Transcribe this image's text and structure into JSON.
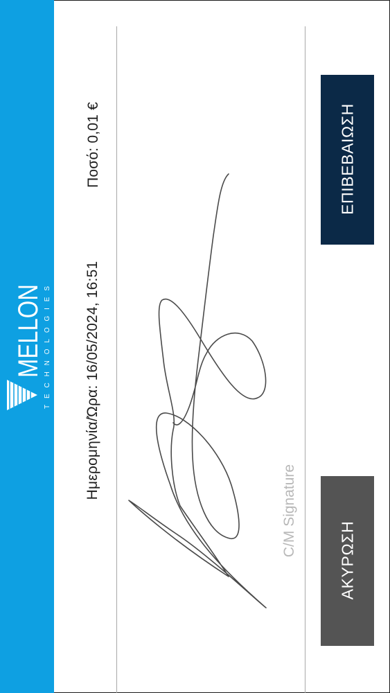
{
  "brand": {
    "name": "MELLON",
    "tagline": "TECHNOLOGIES",
    "color": "#0ea0e2"
  },
  "transaction": {
    "datetime_label": "Ημερομηνία/Ώρα:",
    "datetime_value": "16/05/2024, 16:51",
    "amount_label": "Ποσό:",
    "amount_value": "0,01 €"
  },
  "signature": {
    "label": "C/M Signature"
  },
  "buttons": {
    "confirm_label": "ΕΠΙΒΕΒΑΙΩΣΗ",
    "confirm_color": "#0b2947",
    "cancel_label": "ΑΚΥΡΩΣΗ",
    "cancel_color": "#545454"
  }
}
